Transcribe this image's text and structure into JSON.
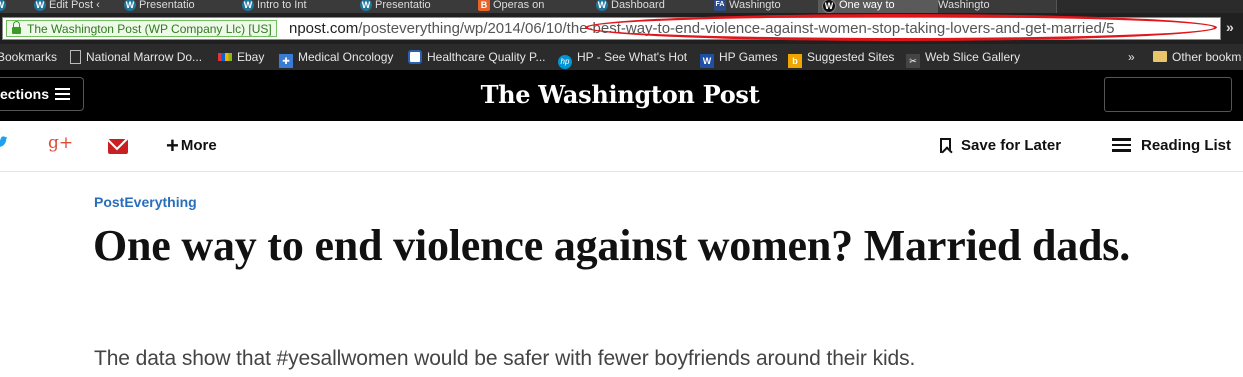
{
  "browser": {
    "tabs": [
      {
        "label": "",
        "favicon": "wordpress-icon"
      },
      {
        "label": "Edit Post ‹",
        "favicon": "wordpress-icon"
      },
      {
        "label": "Presentatio",
        "favicon": "wordpress-icon"
      },
      {
        "label": "Intro to Int",
        "favicon": "wordpress-icon"
      },
      {
        "label": "Presentatio",
        "favicon": "wordpress-icon"
      },
      {
        "label": "Operas on",
        "favicon": "blogger-icon"
      },
      {
        "label": "Dashboard",
        "favicon": "wordpress-icon"
      },
      {
        "label": "Washingto",
        "favicon": "fa-icon"
      },
      {
        "label": "One way to",
        "favicon": "wapo-icon"
      },
      {
        "label": "Washingto",
        "favicon": ""
      }
    ],
    "ev_label": "The Washington Post (WP Company Llc) [US]",
    "url_domain": "npost.com",
    "url_path": "/posteverything/wp/2014/06/10/the-best-way-to-end-violence-against-women-stop-taking-lovers-and-get-married/5",
    "ext_arrow": "»",
    "highlight_color": "#e0161b",
    "bookmarks": [
      {
        "label": "Bookmarks",
        "icon": "none"
      },
      {
        "label": "National Marrow Do...",
        "icon": "page-icon"
      },
      {
        "label": "Ebay",
        "icon": "ebay-icon"
      },
      {
        "label": "Medical Oncology",
        "icon": "medical-icon"
      },
      {
        "label": "Healthcare Quality P...",
        "icon": "hq-icon"
      },
      {
        "label": "HP - See What's Hot",
        "icon": "hp-icon"
      },
      {
        "label": "HP Games",
        "icon": "hp-games-icon"
      },
      {
        "label": "Suggested Sites",
        "icon": "suggested-sites-icon"
      },
      {
        "label": "Web Slice Gallery",
        "icon": "web-slice-icon"
      }
    ],
    "bookmarks_overflow": "»",
    "other_bookmarks": "Other bookm"
  },
  "site": {
    "sections_label": "ections",
    "logo": "The Washington Post"
  },
  "share": {
    "gplus_glyph": "g+",
    "more_label": "More",
    "save_label": "Save for Later",
    "reading_label": "Reading List"
  },
  "article": {
    "kicker": "PostEverything",
    "headline": "One way to end violence against women? Married dads.",
    "dek": "The data show that #yesallwomen would be safer with fewer boyfriends around their kids."
  }
}
